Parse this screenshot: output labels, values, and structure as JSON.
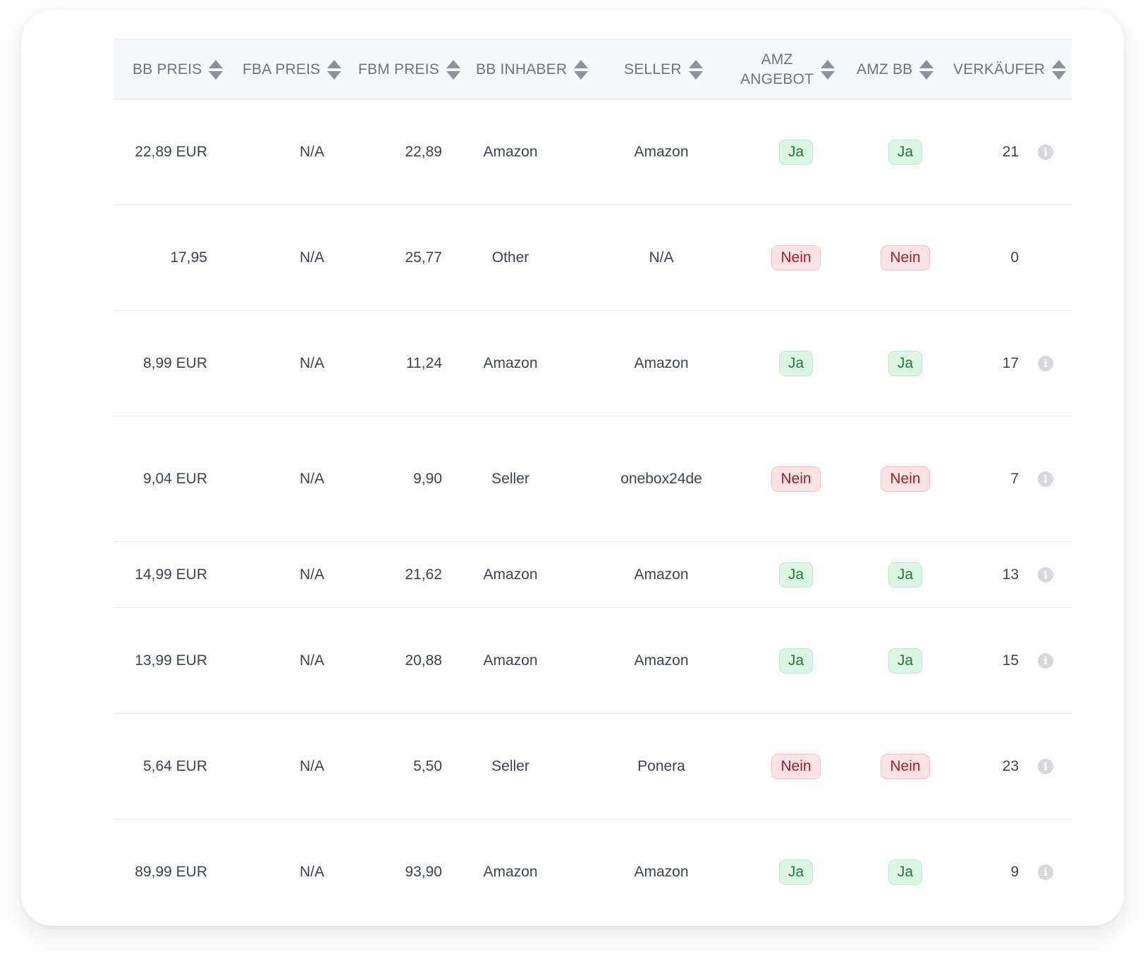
{
  "table": {
    "headers": {
      "bb_preis": "BB PREIS",
      "fba_preis": "FBA PREIS",
      "fbm_preis": "FBM PREIS",
      "bb_inhaber": "BB INHABER",
      "seller": "SELLER",
      "amz_angebot_line1": "AMZ",
      "amz_angebot_line2": "ANGEBOT",
      "amz_bb": "AMZ BB",
      "verkaeufer": "VERKÄUFER"
    },
    "rows": [
      {
        "bb_preis": "22,89 EUR",
        "fba_preis": "N/A",
        "fbm_preis": "22,89",
        "bb_inhaber": "Amazon",
        "seller": "Amazon",
        "amz_angebot": "Ja",
        "amz_bb": "Ja",
        "verkaeufer": "21",
        "has_info": true
      },
      {
        "bb_preis": "17,95",
        "fba_preis": "N/A",
        "fbm_preis": "25,77",
        "bb_inhaber": "Other",
        "seller": "N/A",
        "amz_angebot": "Nein",
        "amz_bb": "Nein",
        "verkaeufer": "0",
        "has_info": false
      },
      {
        "bb_preis": "8,99 EUR",
        "fba_preis": "N/A",
        "fbm_preis": "11,24",
        "bb_inhaber": "Amazon",
        "seller": "Amazon",
        "amz_angebot": "Ja",
        "amz_bb": "Ja",
        "verkaeufer": "17",
        "has_info": true
      },
      {
        "bb_preis": "9,04 EUR",
        "fba_preis": "N/A",
        "fbm_preis": "9,90",
        "bb_inhaber": "Seller",
        "seller": "onebox24de",
        "amz_angebot": "Nein",
        "amz_bb": "Nein",
        "verkaeufer": "7",
        "has_info": true
      },
      {
        "bb_preis": "14,99 EUR",
        "fba_preis": "N/A",
        "fbm_preis": "21,62",
        "bb_inhaber": "Amazon",
        "seller": "Amazon",
        "amz_angebot": "Ja",
        "amz_bb": "Ja",
        "verkaeufer": "13",
        "has_info": true
      },
      {
        "bb_preis": "13,99 EUR",
        "fba_preis": "N/A",
        "fbm_preis": "20,88",
        "bb_inhaber": "Amazon",
        "seller": "Amazon",
        "amz_angebot": "Ja",
        "amz_bb": "Ja",
        "verkaeufer": "15",
        "has_info": true
      },
      {
        "bb_preis": "5,64 EUR",
        "fba_preis": "N/A",
        "fbm_preis": "5,50",
        "bb_inhaber": "Seller",
        "seller": "Ponera",
        "amz_angebot": "Nein",
        "amz_bb": "Nein",
        "verkaeufer": "23",
        "has_info": true
      },
      {
        "bb_preis": "89,99 EUR",
        "fba_preis": "N/A",
        "fbm_preis": "93,90",
        "bb_inhaber": "Amazon",
        "seller": "Amazon",
        "amz_angebot": "Ja",
        "amz_bb": "Ja",
        "verkaeufer": "9",
        "has_info": true
      }
    ]
  },
  "badge_values": {
    "yes": "Ja",
    "no": "Nein"
  },
  "info_icon": "info-icon",
  "sort_icon": "sort-icon",
  "colors": {
    "yes_bg": "#dcf6e4",
    "yes_text": "#1f7a3e",
    "no_bg": "#fde3e3",
    "no_text": "#a61d24",
    "header_bg": "#f6f9fb",
    "header_text": "#6b7480"
  }
}
